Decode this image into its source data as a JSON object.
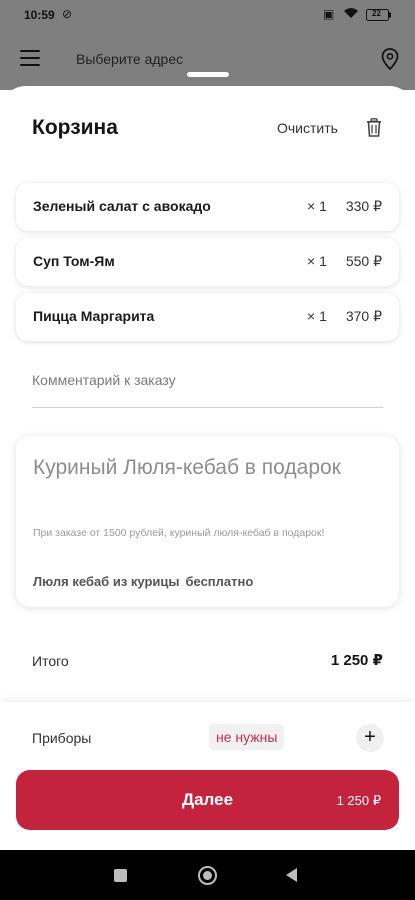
{
  "status_bar": {
    "time": "10:59",
    "battery": "22"
  },
  "app_bar": {
    "address_placeholder": "Выберите адрес"
  },
  "cart": {
    "title": "Корзина",
    "clear_label": "Очистить",
    "items": [
      {
        "name": "Зеленый салат с авокадо",
        "qty": "× 1",
        "price": "330 ₽"
      },
      {
        "name": "Суп Том-Ям",
        "qty": "× 1",
        "price": "550 ₽"
      },
      {
        "name": "Пицца Маргарита",
        "qty": "× 1",
        "price": "370 ₽"
      }
    ],
    "comment_placeholder": "Комментарий к заказу"
  },
  "promo": {
    "title": "Куриный Люля-кебаб в подарок",
    "description": "При заказе от 1500 рублей, куриный люля-кебаб в подарок!",
    "gift_name": "Люля кебаб из курицы",
    "gift_price": "бесплатно"
  },
  "summary": {
    "total_label": "Итого",
    "total_value": "1 250 ₽"
  },
  "cutlery": {
    "label": "Приборы",
    "value": "не нужны"
  },
  "next_button": {
    "label": "Далее",
    "amount": "1 250 ₽"
  },
  "colors": {
    "accent": "#c4233e",
    "overlay": "#7f7f7f"
  }
}
